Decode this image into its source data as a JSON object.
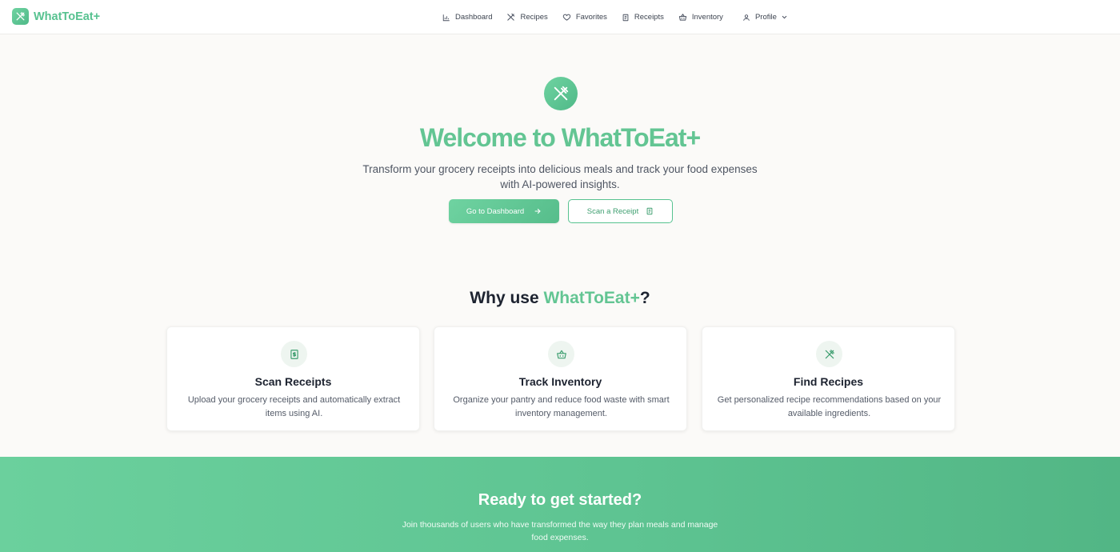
{
  "app": {
    "name": "WhatToEat+",
    "colors": {
      "accent": "#5ec492",
      "accent_dark": "#3d9e6f",
      "background": "#fbfaf8"
    }
  },
  "nav": {
    "items": [
      {
        "label": "Dashboard",
        "icon": "bar-chart-icon"
      },
      {
        "label": "Recipes",
        "icon": "utensils-icon"
      },
      {
        "label": "Favorites",
        "icon": "heart-icon"
      },
      {
        "label": "Receipts",
        "icon": "receipt-icon"
      },
      {
        "label": "Inventory",
        "icon": "basket-icon"
      }
    ],
    "profile": {
      "label": "Profile",
      "icon": "user-icon"
    }
  },
  "hero": {
    "icon": "utensils-icon",
    "title": "Welcome to WhatToEat+",
    "subtitle": "Transform your grocery receipts into delicious meals and track your food expenses with AI-powered insights.",
    "primary_button": "Go to Dashboard",
    "secondary_button": "Scan a Receipt"
  },
  "why": {
    "title_prefix": "Why use ",
    "title_accent": "WhatToEat+",
    "title_suffix": "?",
    "cards": [
      {
        "icon": "receipt-icon",
        "title": "Scan Receipts",
        "description": "Upload your grocery receipts and automatically extract items using AI."
      },
      {
        "icon": "basket-icon",
        "title": "Track Inventory",
        "description": "Organize your pantry and reduce food waste with smart inventory management."
      },
      {
        "icon": "utensils-icon",
        "title": "Find Recipes",
        "description": "Get personalized recipe recommendations based on your available ingredients."
      }
    ]
  },
  "cta": {
    "title": "Ready to get started?",
    "subtitle": "Join thousands of users who have transformed the way they plan meals and manage food expenses."
  }
}
